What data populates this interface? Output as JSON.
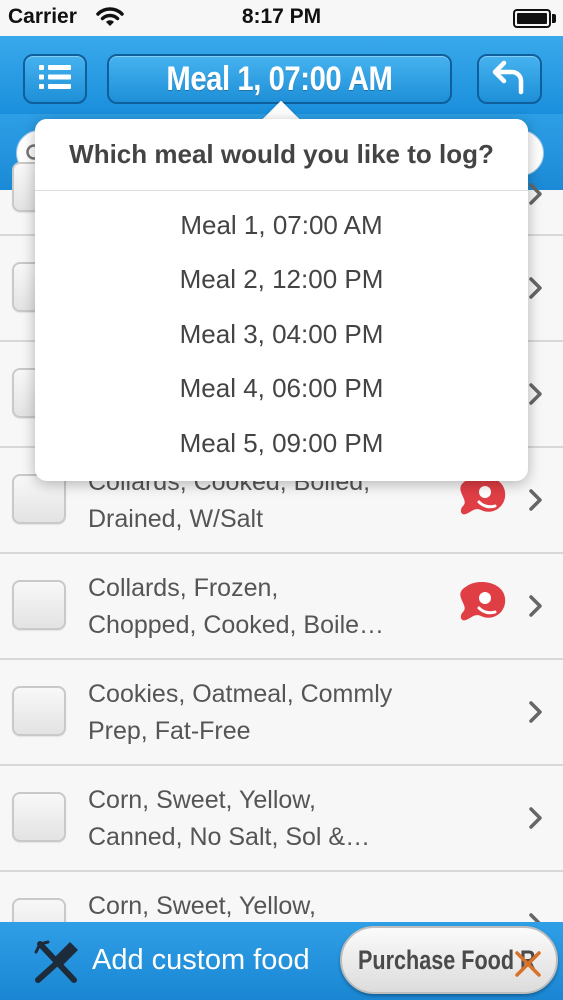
{
  "status_bar": {
    "carrier": "Carrier",
    "time": "8:17 PM",
    "battery_level": 1.0
  },
  "nav": {
    "title": "Meal 1, 07:00 AM",
    "menu_icon": "list-icon",
    "back_icon": "undo-arrow-icon"
  },
  "search": {
    "placeholder": "",
    "icon": "search-icon"
  },
  "food_list": {
    "items": [
      {
        "name": "",
        "meat": false
      },
      {
        "name": "",
        "meat": true
      },
      {
        "name": "",
        "meat": true
      },
      {
        "name": "Collards, Cooked, Boiled,\nDrained, W/Salt",
        "meat": true
      },
      {
        "name": "Collards, Frozen,\nChopped, Cooked, Boile…",
        "meat": true
      },
      {
        "name": "Cookies, Oatmeal, Commly\nPrep, Fat-Free",
        "meat": false
      },
      {
        "name": "Corn, Sweet, Yellow,\nCanned, No Salt, Sol &…",
        "meat": false
      },
      {
        "name": "Corn, Sweet, Yellow,",
        "meat": false
      }
    ]
  },
  "meal_picker": {
    "title": "Which meal would you like to log?",
    "options": [
      "Meal 1, 07:00 AM",
      "Meal 2, 12:00 PM",
      "Meal 3, 04:00 PM",
      "Meal 4, 06:00 PM",
      "Meal 5, 09:00 PM"
    ]
  },
  "bottom_bar": {
    "add_custom_label": "Add custom food",
    "purchase_label": "Purchase Food R",
    "purchase_icon": "rx-icon"
  },
  "colors": {
    "brand_blue": "#1a8fdc",
    "meat_red": "#e03e45"
  }
}
